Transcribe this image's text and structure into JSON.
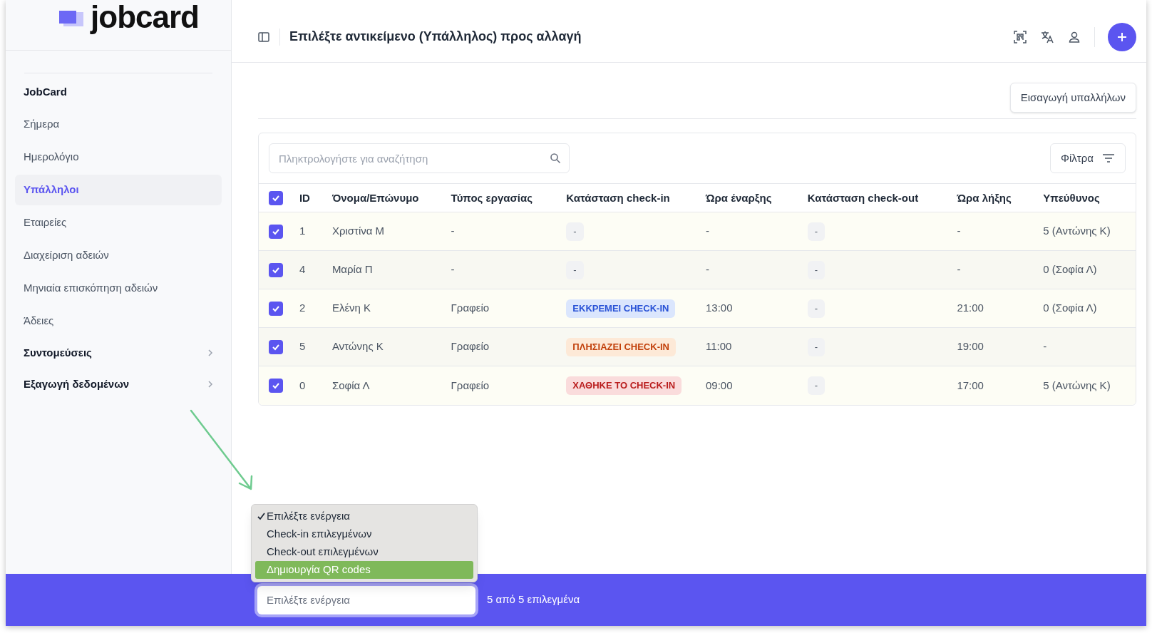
{
  "logo": {
    "text": "jobcard"
  },
  "sidebar": {
    "items": [
      {
        "kind": "heading",
        "label": "JobCard"
      },
      {
        "kind": "link",
        "label": "Σήμερα",
        "selected": false
      },
      {
        "kind": "link",
        "label": "Ημερολόγιο",
        "selected": false
      },
      {
        "kind": "link",
        "label": "Υπάλληλοι",
        "selected": true
      },
      {
        "kind": "link",
        "label": "Εταιρείες",
        "selected": false
      },
      {
        "kind": "link",
        "label": "Διαχείριση αδειών",
        "selected": false
      },
      {
        "kind": "link",
        "label": "Μηνιαία επισκόπηση αδειών",
        "selected": false
      },
      {
        "kind": "link",
        "label": "Άδειες",
        "selected": false
      },
      {
        "kind": "group",
        "label": "Συντομεύσεις",
        "selected": false
      },
      {
        "kind": "group",
        "label": "Εξαγωγή δεδομένων",
        "selected": false
      }
    ]
  },
  "header": {
    "title": "Επιλέξτε αντικείμενο (Υπάλληλος) προς αλλαγή"
  },
  "import_button": "Εισαγωγή υπαλλήλων",
  "search": {
    "placeholder": "Πληκτρολογήστε για αναζήτηση"
  },
  "filters_button": "Φίλτρα",
  "table": {
    "all_checked": true,
    "columns": [
      "ID",
      "Όνομα/Επώνυμο",
      "Τύπος εργασίας",
      "Κατάσταση check-in",
      "Ώρα έναρξης",
      "Κατάσταση check-out",
      "Ώρα λήξης",
      "Υπεύθυνος"
    ],
    "rows": [
      {
        "checked": true,
        "id": "1",
        "name": "Χριστίνα Μ",
        "work_type": "-",
        "checkin": {
          "text": "-",
          "kind": "none"
        },
        "start": "-",
        "checkout": {
          "text": "-",
          "kind": "none"
        },
        "end": "-",
        "responsible": "5 (Αντώνης Κ)"
      },
      {
        "checked": true,
        "id": "4",
        "name": "Μαρία Π",
        "work_type": "-",
        "checkin": {
          "text": "-",
          "kind": "none"
        },
        "start": "-",
        "checkout": {
          "text": "-",
          "kind": "none"
        },
        "end": "-",
        "responsible": "0 (Σοφία Λ)"
      },
      {
        "checked": true,
        "id": "2",
        "name": "Ελένη Κ",
        "work_type": "Γραφείο",
        "checkin": {
          "text": "ΕΚΚΡΕΜΕΙ CHECK-IN",
          "kind": "pending"
        },
        "start": "13:00",
        "checkout": {
          "text": "-",
          "kind": "none"
        },
        "end": "21:00",
        "responsible": "0 (Σοφία Λ)"
      },
      {
        "checked": true,
        "id": "5",
        "name": "Αντώνης Κ",
        "work_type": "Γραφείο",
        "checkin": {
          "text": "ΠΛΗΣΙΑΖΕΙ CHECK-IN",
          "kind": "approaching"
        },
        "start": "11:00",
        "checkout": {
          "text": "-",
          "kind": "none"
        },
        "end": "19:00",
        "responsible": "-"
      },
      {
        "checked": true,
        "id": "0",
        "name": "Σοφία Λ",
        "work_type": "Γραφείο",
        "checkin": {
          "text": "ΧΑΘΗΚΕ ΤΟ CHECK-IN",
          "kind": "missed"
        },
        "start": "09:00",
        "checkout": {
          "text": "-",
          "kind": "none"
        },
        "end": "17:00",
        "responsible": "5 (Αντώνης Κ)"
      }
    ]
  },
  "action_menu": {
    "options": [
      {
        "label": "Επιλέξτε ενέργεια",
        "checked": true,
        "selected": false
      },
      {
        "label": "Check-in επιλεγμένων",
        "checked": false,
        "selected": false
      },
      {
        "label": "Check-out επιλεγμένων",
        "checked": false,
        "selected": false
      },
      {
        "label": "Δημιουργία QR codes",
        "checked": false,
        "selected": true
      }
    ]
  },
  "action_select": {
    "placeholder": "Επιλέξτε ενέργεια"
  },
  "selection_count": "5 από 5 επιλεγμένα"
}
